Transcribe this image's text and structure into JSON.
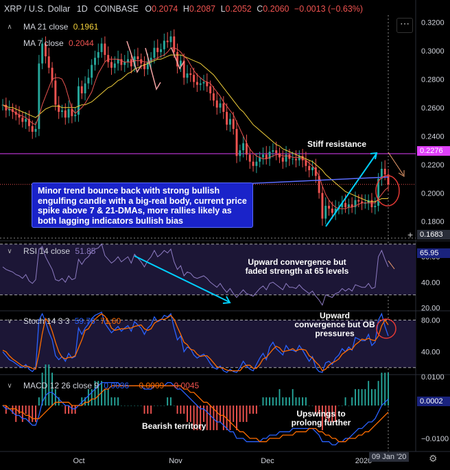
{
  "header": {
    "symbol": "XRP / U.S. Dollar",
    "interval": "1D",
    "exchange": "COINBASE",
    "o_label": "O",
    "o_value": "0.2074",
    "h_label": "H",
    "h_value": "0.2087",
    "l_label": "L",
    "l_value": "0.2052",
    "c_label": "C",
    "c_value": "0.2060",
    "change": "−0.0013 (−0.63%)"
  },
  "indicators": {
    "ma21_label": "MA 21 close",
    "ma21_value": "0.1961",
    "ma7_label": "MA 7 close",
    "ma7_value": "0.2044",
    "rsi_label": "RSI 14 close",
    "rsi_value": "51.85",
    "stoch_label": "Stoch 14 3 3",
    "stoch_k": "59.76",
    "stoch_d": "71.60",
    "macd_label": "MACD 12 26 close 9",
    "macd_value": "0.0036",
    "macd_signal": "−0.0009",
    "macd_hist": "−0.0045"
  },
  "annotations": {
    "callout": "Minor trend bounce back with strong bullish engulfing candle with a big-real body, current price spike above 7 & 21-DMAs, more rallies likely as both lagging indicators bullish bias",
    "resistance": "Stiff resistance",
    "rsi_note": "Upward convergence but faded strength at 65 levels",
    "stoch_note": "Upward convergence but OB pressures",
    "macd_bear": "Bearish territory",
    "macd_up": "Upswings to prolong further"
  },
  "badges": {
    "resistance": "0.2276",
    "crosshair": "0.1683",
    "rsi": "65.95",
    "macd": "0.0002",
    "date": "09 Jan '20"
  },
  "colors": {
    "bg": "#000000",
    "up": "#26a69a",
    "down": "#ef5350",
    "ma21": "#f2d03b",
    "ma7": "#e8534f",
    "rsi": "#8e7cc3",
    "stoch_k": "#2962ff",
    "stoch_d": "#ff6d00",
    "macd": "#2962ff",
    "signal": "#ff6d00",
    "resistance": "#e040fb",
    "callout": "#1a23c9",
    "arrow": "#00d0ff"
  },
  "chart_data": [
    {
      "type": "candlestick",
      "title": "XRP / U.S. Dollar 1D COINBASE",
      "x_ticks": [
        "Oct",
        "Nov",
        "Dec",
        "2020"
      ],
      "ylim": [
        0.1683,
        0.325
      ],
      "y_ticks": [
        0.18,
        0.2,
        0.22,
        0.24,
        0.26,
        0.28,
        0.3,
        0.32
      ],
      "y_tick_labels": [
        "0.1800",
        "0.2000",
        "0.2200",
        "0.2400",
        "0.2600",
        "0.2800",
        "0.3000",
        "0.3200"
      ],
      "close": [
        0.262,
        0.258,
        0.259,
        0.257,
        0.255,
        0.253,
        0.25,
        0.252,
        0.247,
        0.243,
        0.245,
        0.291,
        0.305,
        0.296,
        0.288,
        0.279,
        0.262,
        0.257,
        0.258,
        0.253,
        0.259,
        0.254,
        0.255,
        0.275,
        0.27,
        0.277,
        0.281,
        0.29,
        0.295,
        0.299,
        0.305,
        0.297,
        0.292,
        0.288,
        0.291,
        0.294,
        0.29,
        0.292,
        0.294,
        0.289,
        0.296,
        0.294,
        0.291,
        0.287,
        0.292,
        0.295,
        0.302,
        0.299,
        0.301,
        0.307,
        0.306,
        0.31,
        0.299,
        0.289,
        0.293,
        0.281,
        0.284,
        0.283,
        0.278,
        0.276,
        0.277,
        0.278,
        0.275,
        0.27,
        0.265,
        0.26,
        0.263,
        0.257,
        0.248,
        0.252,
        0.245,
        0.226,
        0.23,
        0.235,
        0.227,
        0.222,
        0.219,
        0.222,
        0.225,
        0.227,
        0.224,
        0.229,
        0.23,
        0.228,
        0.225,
        0.222,
        0.227,
        0.224,
        0.224,
        0.223,
        0.226,
        0.223,
        0.219,
        0.216,
        0.218,
        0.212,
        0.2,
        0.182,
        0.191,
        0.189,
        0.186,
        0.189,
        0.19,
        0.193,
        0.19,
        0.192,
        0.19,
        0.195,
        0.194,
        0.193,
        0.193,
        0.195,
        0.19,
        0.191,
        0.21,
        0.217,
        0.213,
        0.206
      ],
      "ma21": [
        0.262,
        0.261,
        0.26,
        0.26,
        0.259,
        0.258,
        0.257,
        0.256,
        0.255,
        0.254,
        0.253,
        0.255,
        0.257,
        0.259,
        0.26,
        0.261,
        0.261,
        0.261,
        0.26,
        0.26,
        0.26,
        0.26,
        0.26,
        0.261,
        0.262,
        0.262,
        0.263,
        0.264,
        0.266,
        0.268,
        0.27,
        0.272,
        0.274,
        0.275,
        0.277,
        0.279,
        0.28,
        0.282,
        0.284,
        0.285,
        0.287,
        0.288,
        0.289,
        0.29,
        0.291,
        0.292,
        0.293,
        0.294,
        0.294,
        0.295,
        0.296,
        0.297,
        0.297,
        0.297,
        0.297,
        0.296,
        0.295,
        0.294,
        0.293,
        0.292,
        0.291,
        0.289,
        0.287,
        0.285,
        0.283,
        0.28,
        0.277,
        0.274,
        0.271,
        0.268,
        0.265,
        0.262,
        0.259,
        0.257,
        0.254,
        0.251,
        0.248,
        0.246,
        0.244,
        0.242,
        0.24,
        0.238,
        0.236,
        0.234,
        0.233,
        0.231,
        0.23,
        0.229,
        0.228,
        0.227,
        0.226,
        0.225,
        0.224,
        0.223,
        0.222,
        0.22,
        0.218,
        0.216,
        0.213,
        0.211,
        0.209,
        0.207,
        0.205,
        0.203,
        0.201,
        0.2,
        0.199,
        0.198,
        0.197,
        0.196,
        0.195,
        0.194,
        0.194,
        0.194,
        0.195,
        0.196,
        0.196,
        0.196
      ],
      "ma7": [
        0.262,
        0.26,
        0.259,
        0.258,
        0.256,
        0.255,
        0.254,
        0.253,
        0.251,
        0.249,
        0.248,
        0.254,
        0.262,
        0.268,
        0.274,
        0.28,
        0.281,
        0.281,
        0.28,
        0.275,
        0.267,
        0.259,
        0.256,
        0.258,
        0.26,
        0.263,
        0.267,
        0.271,
        0.278,
        0.284,
        0.288,
        0.292,
        0.294,
        0.294,
        0.294,
        0.294,
        0.293,
        0.292,
        0.292,
        0.292,
        0.293,
        0.293,
        0.293,
        0.292,
        0.292,
        0.293,
        0.294,
        0.295,
        0.296,
        0.297,
        0.299,
        0.302,
        0.302,
        0.301,
        0.299,
        0.296,
        0.294,
        0.29,
        0.286,
        0.283,
        0.281,
        0.279,
        0.278,
        0.277,
        0.274,
        0.271,
        0.268,
        0.264,
        0.261,
        0.258,
        0.255,
        0.25,
        0.245,
        0.24,
        0.235,
        0.231,
        0.228,
        0.226,
        0.225,
        0.224,
        0.224,
        0.225,
        0.226,
        0.227,
        0.227,
        0.226,
        0.226,
        0.226,
        0.225,
        0.225,
        0.225,
        0.224,
        0.223,
        0.221,
        0.219,
        0.216,
        0.212,
        0.205,
        0.199,
        0.195,
        0.192,
        0.19,
        0.189,
        0.189,
        0.189,
        0.19,
        0.19,
        0.191,
        0.192,
        0.193,
        0.193,
        0.193,
        0.193,
        0.193,
        0.196,
        0.199,
        0.202,
        0.204
      ]
    },
    {
      "type": "line",
      "name": "RSI 14 close",
      "ylim": [
        18,
        72
      ],
      "y_ticks": [
        20,
        40,
        60
      ],
      "y_tick_labels": [
        "20.00",
        "40.00",
        "60.00"
      ],
      "hlines": [
        70,
        30
      ],
      "values": [
        52,
        50,
        49,
        48,
        46,
        45,
        43,
        46,
        41,
        39,
        42,
        66,
        68,
        60,
        55,
        50,
        42,
        41,
        43,
        40,
        45,
        42,
        43,
        58,
        54,
        58,
        60,
        64,
        66,
        67,
        70,
        61,
        58,
        55,
        57,
        60,
        56,
        58,
        60,
        55,
        62,
        59,
        56,
        52,
        57,
        60,
        65,
        60,
        62,
        65,
        63,
        66,
        56,
        50,
        53,
        45,
        48,
        47,
        44,
        43,
        44,
        45,
        43,
        40,
        38,
        36,
        39,
        35,
        32,
        35,
        31,
        28,
        31,
        34,
        31,
        30,
        29,
        32,
        35,
        37,
        34,
        39,
        40,
        38,
        36,
        34,
        39,
        36,
        36,
        35,
        38,
        35,
        33,
        31,
        33,
        29,
        26,
        22,
        30,
        29,
        28,
        31,
        32,
        35,
        33,
        35,
        33,
        38,
        37,
        36,
        36,
        39,
        35,
        36,
        60,
        65,
        58,
        52
      ]
    },
    {
      "type": "line",
      "name": "Stoch 14 3 3",
      "ylim": [
        12,
        90
      ],
      "y_ticks": [
        40,
        80
      ],
      "y_tick_labels": [
        "40.00",
        "80.00"
      ],
      "hlines": [
        80,
        20
      ],
      "k": [
        40,
        35,
        30,
        28,
        25,
        22,
        20,
        24,
        18,
        15,
        20,
        80,
        88,
        78,
        65,
        55,
        35,
        30,
        34,
        28,
        38,
        32,
        34,
        70,
        62,
        70,
        75,
        82,
        86,
        88,
        90,
        76,
        70,
        64,
        68,
        72,
        66,
        70,
        73,
        66,
        78,
        74,
        70,
        62,
        70,
        74,
        84,
        78,
        80,
        86,
        84,
        88,
        70,
        55,
        60,
        40,
        46,
        44,
        36,
        32,
        35,
        37,
        32,
        25,
        20,
        18,
        22,
        16,
        14,
        18,
        15,
        14,
        20,
        28,
        22,
        18,
        16,
        24,
        32,
        38,
        30,
        46,
        52,
        44,
        40,
        36,
        48,
        42,
        42,
        40,
        48,
        42,
        35,
        28,
        34,
        20,
        15,
        14,
        26,
        28,
        24,
        32,
        36,
        44,
        40,
        46,
        42,
        58,
        56,
        54,
        54,
        62,
        48,
        52,
        80,
        88,
        72,
        60
      ],
      "d": [
        42,
        40,
        35,
        31,
        28,
        25,
        22,
        22,
        21,
        19,
        18,
        38,
        63,
        82,
        77,
        66,
        52,
        40,
        33,
        31,
        33,
        33,
        35,
        45,
        55,
        67,
        69,
        76,
        81,
        85,
        88,
        85,
        79,
        70,
        67,
        68,
        69,
        69,
        70,
        70,
        72,
        73,
        74,
        69,
        67,
        69,
        76,
        79,
        81,
        81,
        83,
        86,
        81,
        71,
        62,
        52,
        49,
        43,
        42,
        37,
        34,
        35,
        35,
        31,
        26,
        21,
        20,
        19,
        17,
        16,
        16,
        16,
        16,
        21,
        23,
        23,
        19,
        19,
        24,
        31,
        33,
        38,
        43,
        47,
        45,
        40,
        41,
        42,
        44,
        41,
        43,
        43,
        42,
        35,
        32,
        27,
        23,
        16,
        18,
        23,
        26,
        28,
        31,
        37,
        40,
        43,
        43,
        49,
        52,
        56,
        55,
        57,
        55,
        54,
        60,
        73,
        80,
        74
      ]
    },
    {
      "type": "bar+line",
      "name": "MACD 12 26 close 9",
      "ylim": [
        -0.014,
        0.009
      ],
      "y_ticks": [
        0.0,
        -0.01
      ],
      "y_tick_labels": [
        "0.0002",
        "−0.0100"
      ],
      "extra_label": "0.0100",
      "macd": [
        0.0,
        -0.001,
        -0.001,
        -0.002,
        -0.003,
        -0.003,
        -0.004,
        -0.004,
        -0.005,
        -0.006,
        -0.006,
        -0.003,
        0.001,
        0.003,
        0.004,
        0.004,
        0.003,
        0.002,
        0.001,
        0.0,
        0.0,
        -0.001,
        -0.001,
        0.0,
        0.001,
        0.002,
        0.003,
        0.004,
        0.005,
        0.006,
        0.007,
        0.007,
        0.007,
        0.007,
        0.007,
        0.007,
        0.006,
        0.006,
        0.006,
        0.006,
        0.006,
        0.006,
        0.006,
        0.005,
        0.005,
        0.005,
        0.006,
        0.006,
        0.006,
        0.006,
        0.007,
        0.007,
        0.006,
        0.005,
        0.005,
        0.004,
        0.003,
        0.002,
        0.001,
        0.0,
        -0.001,
        -0.001,
        -0.002,
        -0.003,
        -0.004,
        -0.005,
        -0.005,
        -0.006,
        -0.007,
        -0.008,
        -0.008,
        -0.01,
        -0.01,
        -0.01,
        -0.011,
        -0.011,
        -0.011,
        -0.011,
        -0.011,
        -0.01,
        -0.01,
        -0.009,
        -0.009,
        -0.009,
        -0.008,
        -0.008,
        -0.008,
        -0.008,
        -0.007,
        -0.007,
        -0.007,
        -0.007,
        -0.007,
        -0.007,
        -0.007,
        -0.008,
        -0.009,
        -0.011,
        -0.011,
        -0.011,
        -0.012,
        -0.012,
        -0.011,
        -0.011,
        -0.01,
        -0.01,
        -0.009,
        -0.008,
        -0.007,
        -0.007,
        -0.006,
        -0.005,
        -0.005,
        -0.004,
        -0.002,
        0.0,
        0.001,
        0.002
      ],
      "signal": [
        0.0,
        0.0,
        -0.001,
        -0.001,
        -0.001,
        -0.002,
        -0.002,
        -0.003,
        -0.003,
        -0.004,
        -0.004,
        -0.004,
        -0.003,
        -0.002,
        -0.001,
        0.0,
        0.001,
        0.001,
        0.001,
        0.001,
        0.001,
        0.0,
        0.0,
        0.0,
        0.0,
        0.001,
        0.001,
        0.002,
        0.002,
        0.003,
        0.004,
        0.005,
        0.005,
        0.006,
        0.006,
        0.006,
        0.006,
        0.006,
        0.006,
        0.006,
        0.006,
        0.006,
        0.006,
        0.006,
        0.006,
        0.006,
        0.006,
        0.006,
        0.006,
        0.006,
        0.006,
        0.006,
        0.006,
        0.006,
        0.006,
        0.005,
        0.005,
        0.004,
        0.004,
        0.003,
        0.002,
        0.001,
        0.001,
        0.0,
        -0.001,
        -0.002,
        -0.003,
        -0.003,
        -0.004,
        -0.005,
        -0.006,
        -0.007,
        -0.008,
        -0.008,
        -0.009,
        -0.01,
        -0.01,
        -0.01,
        -0.011,
        -0.011,
        -0.011,
        -0.01,
        -0.01,
        -0.01,
        -0.01,
        -0.009,
        -0.009,
        -0.009,
        -0.009,
        -0.008,
        -0.008,
        -0.008,
        -0.008,
        -0.007,
        -0.007,
        -0.007,
        -0.008,
        -0.008,
        -0.009,
        -0.009,
        -0.01,
        -0.01,
        -0.011,
        -0.011,
        -0.011,
        -0.01,
        -0.01,
        -0.01,
        -0.009,
        -0.009,
        -0.008,
        -0.008,
        -0.007,
        -0.006,
        -0.005,
        -0.004,
        -0.003,
        -0.002
      ]
    }
  ]
}
